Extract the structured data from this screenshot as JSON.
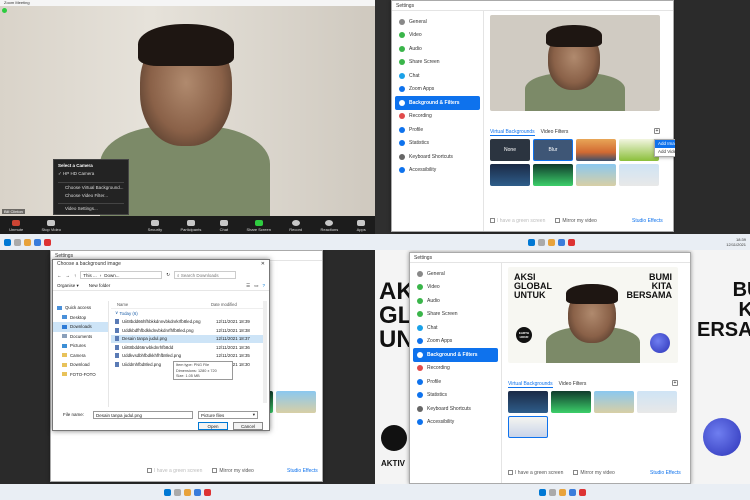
{
  "zoom_meeting": {
    "title": "Zoom Meeting",
    "camera_menu": {
      "header": "Select a Camera",
      "items": [
        "HP HD Camera",
        "Choose Virtual Background...",
        "Choose Video Filter...",
        "Video Settings..."
      ]
    },
    "user_label": "Bill Clinton",
    "controls": [
      "Unmute",
      "Stop Video",
      "Security",
      "Participants",
      "Chat",
      "Share Screen",
      "Record",
      "Reactions",
      "Apps"
    ]
  },
  "settings": {
    "title": "Settings",
    "sidebar": [
      "General",
      "Video",
      "Audio",
      "Share Screen",
      "Chat",
      "Zoom Apps",
      "Background & Filters",
      "Recording",
      "Profile",
      "Statistics",
      "Keyboard Shortcuts",
      "Accessibility"
    ],
    "tabs": [
      "Virtual Backgrounds",
      "Video Filters"
    ],
    "thumbs": [
      "None",
      "Blur"
    ],
    "add_menu": [
      "Add Image",
      "Add Video"
    ],
    "green_screen": "I have a green screen",
    "mirror": "Mirror my video",
    "studio": "Studio Effects"
  },
  "file_dialog": {
    "title": "Choose a background image",
    "window_title": "Settings",
    "path": [
      "This ...",
      "Down..."
    ],
    "search_placeholder": "Search Downloads",
    "organise": "Organise",
    "new_folder": "New folder",
    "nav": [
      "Quick access",
      "Desktop",
      "Downloads",
      "Documents",
      "Pictures",
      "Camera",
      "Download",
      "FOTO-FOTO"
    ],
    "col_name": "Name",
    "col_date": "Date modified",
    "group": "Today (6)",
    "files": [
      {
        "name": "Uiit8bdd66hfhbkkdnnvbkdnrkrfb8led.png",
        "date": "12/11/2021 18:39"
      },
      {
        "name": "Uddkbdfhfbdkkdnvbkdnrfhfb8led.png",
        "date": "12/11/2021 18:38"
      },
      {
        "name": "Desain tanpa judul.png",
        "date": "12/11/2021 18:37"
      },
      {
        "name": "Uiitt8bdd66nvbkdnrhfb8dd",
        "date": "12/11/2021 18:36"
      },
      {
        "name": "Uddkvsdbhfbdkkhfhfb8led.png",
        "date": "12/11/2021 18:35"
      },
      {
        "name": "Uiiddmhfbd8led.png",
        "date": "12/11/2021 18:30"
      }
    ],
    "tooltip": [
      "Item type: PNG File",
      "Dimensions: 1280 x 720",
      "Size: 1.05 MB"
    ],
    "filename_label": "File name:",
    "filename_value": "Desain tanpa judul.png",
    "filter_value": "Picture files",
    "open": "Open",
    "cancel": "Cancel"
  },
  "poster": {
    "left": [
      "AKSI",
      "GLOBAL",
      "UNTUK"
    ],
    "right": [
      "BUMI",
      "KITA",
      "BERSAMA"
    ],
    "side_left": [
      "AKSI",
      "GLOB",
      "UNTU"
    ],
    "side_right": [
      "BUMI",
      "KITA",
      "ERSAMA"
    ],
    "earth": [
      "EARTH",
      "HOUR"
    ],
    "footer_left": "AKTIV"
  },
  "taskbar": {
    "time": "18:39",
    "date": "12/11/2021"
  }
}
